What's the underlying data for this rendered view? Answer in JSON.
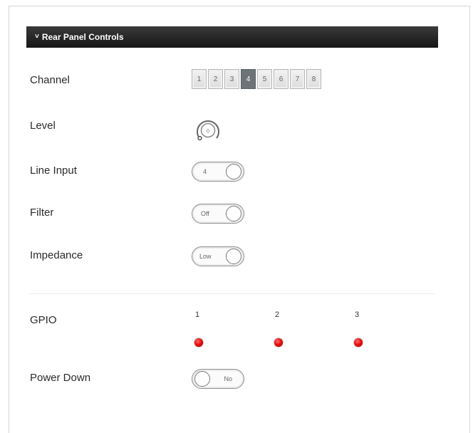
{
  "header": {
    "title": "Rear Panel Controls"
  },
  "labels": {
    "channel": "Channel",
    "level": "Level",
    "line_input": "Line Input",
    "filter": "Filter",
    "impedance": "Impedance",
    "gpio": "GPIO",
    "power_down": "Power Down"
  },
  "channels": [
    "1",
    "2",
    "3",
    "4",
    "5",
    "6",
    "7",
    "8"
  ],
  "selected_channel": "4",
  "level": {
    "value": "0"
  },
  "line_input": {
    "value": "4"
  },
  "filter": {
    "value": "Off"
  },
  "impedance": {
    "value": "Low"
  },
  "gpio": {
    "ports": [
      "1",
      "2",
      "3"
    ],
    "led_color": "#e30000"
  },
  "power_down": {
    "value": "No"
  },
  "icons": {
    "header": "chevron-down-icon",
    "gpio": "led-indicator-icon",
    "level": "rotary-knob-icon"
  }
}
